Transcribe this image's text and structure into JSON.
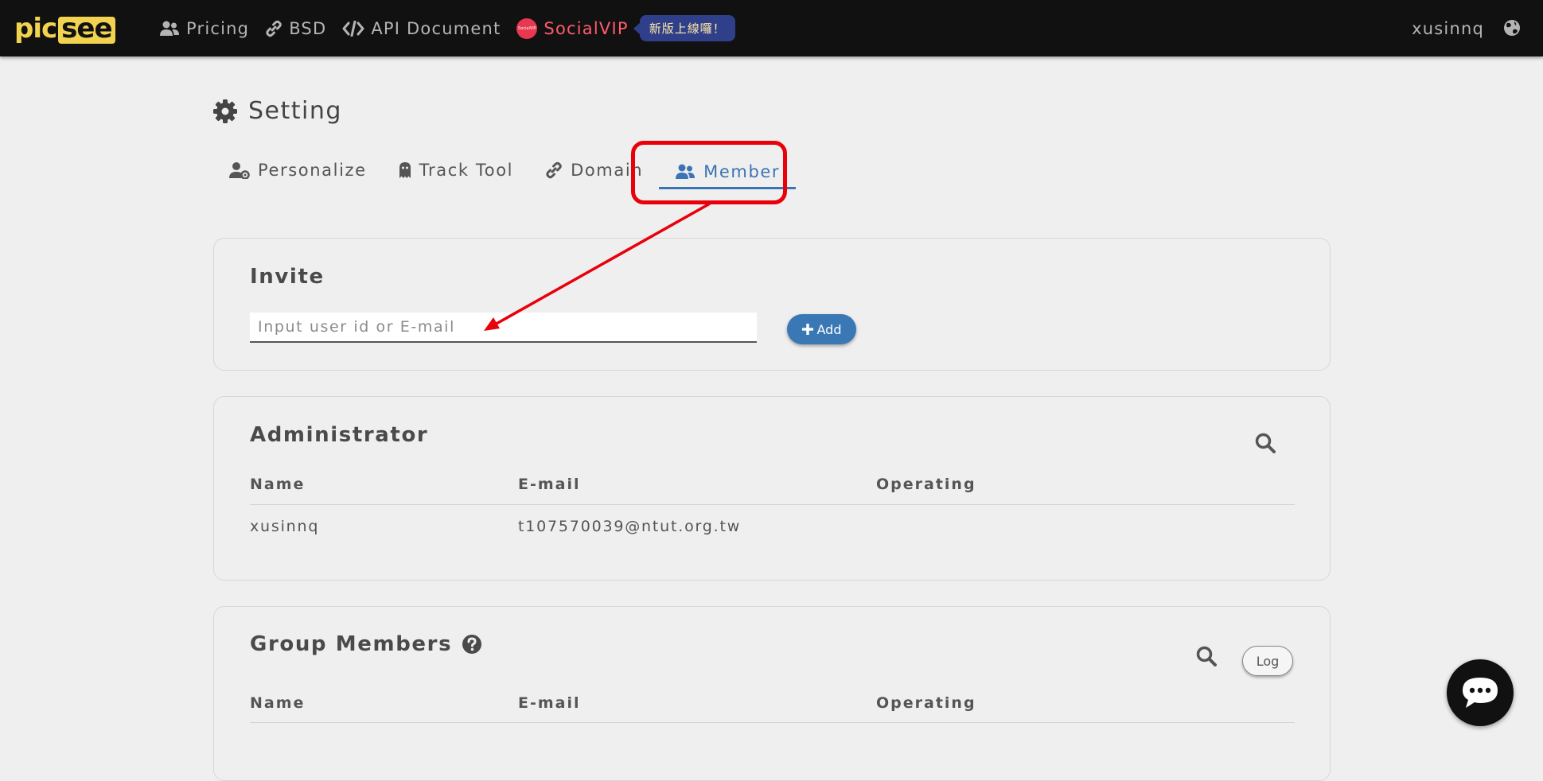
{
  "navbar": {
    "logo_left": "pic",
    "logo_right": "see",
    "items": [
      {
        "label": "Pricing",
        "icon": "users-icon"
      },
      {
        "label": "BSD",
        "icon": "link-icon"
      },
      {
        "label": "API Document",
        "icon": "code-icon"
      }
    ],
    "social": {
      "label": "SocialVIP",
      "dot_text": "SocialVIP",
      "badge": "新版上線囉！"
    },
    "username": "xusinnq",
    "globe_icon": "globe-icon"
  },
  "page": {
    "title": "Setting",
    "title_icon": "gear-icon"
  },
  "tabs": [
    {
      "label": "Personalize",
      "icon": "user-gear-icon",
      "active": false
    },
    {
      "label": "Track Tool",
      "icon": "ghost-icon",
      "active": false
    },
    {
      "label": "Domain",
      "icon": "link-icon",
      "active": false
    },
    {
      "label": "Member",
      "icon": "users-icon",
      "active": true
    }
  ],
  "invite": {
    "title": "Invite",
    "placeholder": "Input user id or E-mail",
    "value": "",
    "add_label": "Add"
  },
  "administrator": {
    "title": "Administrator",
    "columns": [
      "Name",
      "E-mail",
      "Operating"
    ],
    "rows": [
      {
        "name": "xusinnq",
        "email": "t107570039@ntut.org.tw",
        "operating": ""
      }
    ]
  },
  "group_members": {
    "title": "Group Members",
    "columns": [
      "Name",
      "E-mail",
      "Operating"
    ],
    "log_label": "Log"
  },
  "colors": {
    "accent": "#3b74b4",
    "navbar": "#111111",
    "logo": "#f2d34f",
    "social": "#ff5b6b",
    "annotation": "#e8000b"
  }
}
